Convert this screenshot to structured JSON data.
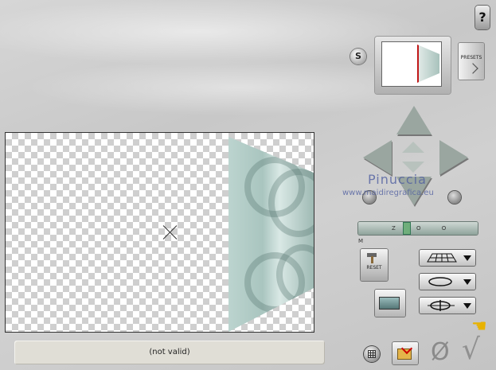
{
  "status": {
    "text": "(not valid)"
  },
  "top": {
    "help_label": "?",
    "shadow_label": "S"
  },
  "presets": {
    "label": "PRESETS"
  },
  "watermark": {
    "name": "Pinuccia",
    "url": "www.maidiregrafica.eu"
  },
  "zoom": {
    "label": "Z O O M"
  },
  "reset": {
    "label": "RESET"
  },
  "buttons": {
    "cancel_symbol": "Ø",
    "ok_symbol": "√",
    "pointer_symbol": "☚"
  }
}
